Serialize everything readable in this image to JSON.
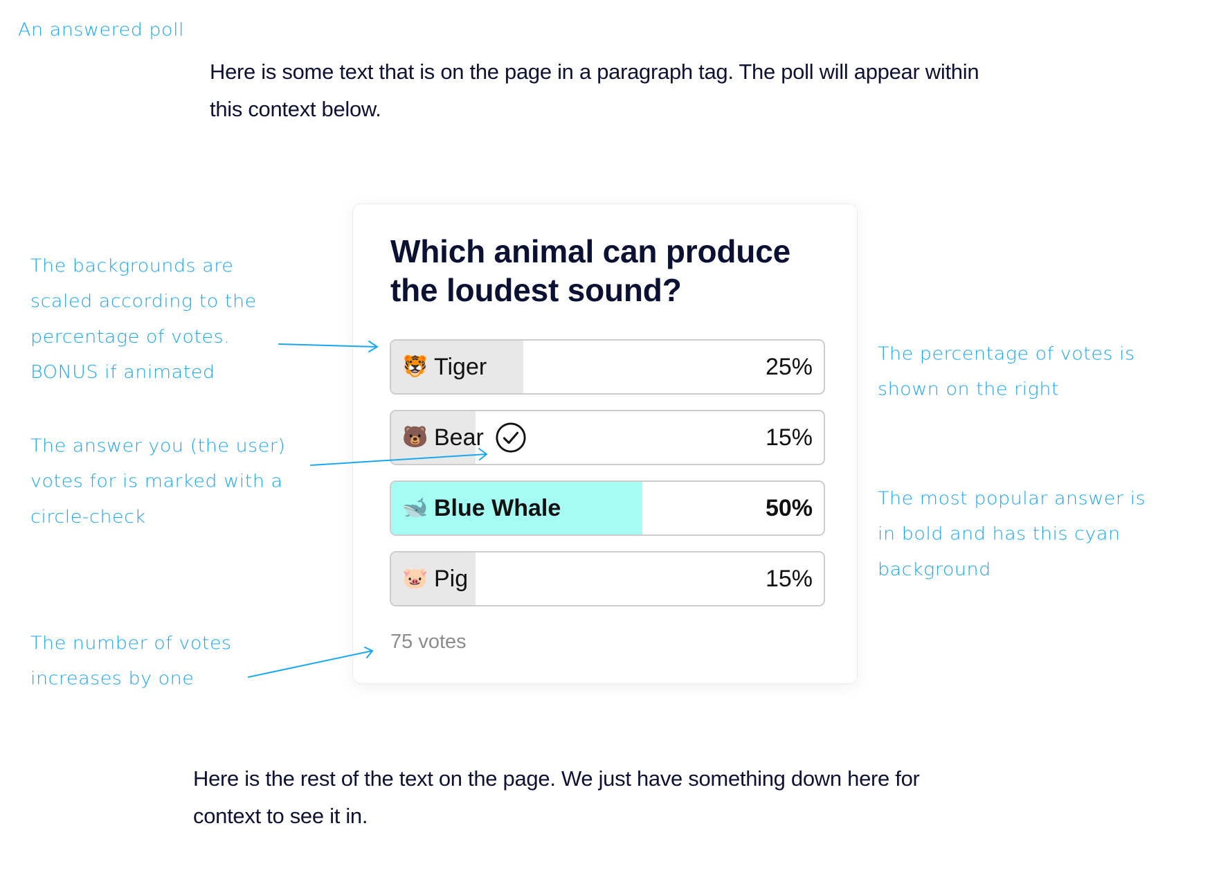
{
  "annotations": {
    "title": "An answered poll",
    "backgrounds_note": [
      "The backgrounds are",
      "scaled according to the",
      "percentage of votes.",
      "BONUS if animated"
    ],
    "user_answer_note": [
      "The answer you (the user)",
      "votes for is marked with a",
      "circle-check"
    ],
    "votes_note": [
      "The number of votes",
      "increases by one"
    ],
    "percentage_note": [
      "The percentage of votes is",
      "shown on the right"
    ],
    "popular_note": [
      "The most popular answer is",
      "in bold and has this cyan",
      "background"
    ]
  },
  "page": {
    "intro_paragraph": [
      "Here is some text that is on the page in a paragraph tag. The poll will appear within",
      "this context below."
    ],
    "outro_paragraph": [
      "Here is the rest of the text on the page. We just have something down here for",
      "context to see it in."
    ]
  },
  "poll": {
    "question": "Which animal can produce the loudest sound?",
    "options": [
      {
        "emoji": "🐯",
        "icon": "tiger-icon",
        "label": "Tiger",
        "percent": 25,
        "percent_label": "25%",
        "selected": false,
        "top": false
      },
      {
        "emoji": "🐻",
        "icon": "bear-icon",
        "label": "Bear",
        "percent": 15,
        "percent_label": "15%",
        "selected": true,
        "top": false
      },
      {
        "emoji": "🐋",
        "icon": "whale-icon",
        "label": "Blue Whale",
        "percent": 50,
        "percent_label": "50%",
        "selected": false,
        "top": true
      },
      {
        "emoji": "🐷",
        "icon": "pig-icon",
        "label": "Pig",
        "percent": 15,
        "percent_label": "15%",
        "selected": false,
        "top": false
      }
    ],
    "votes_label": "75 votes"
  },
  "colors": {
    "annotation": "#1aa7f0",
    "top_fill": "#a5fcf2",
    "fill": "#e8e8e8",
    "text": "#0b1133",
    "muted": "#8c8c8c"
  }
}
